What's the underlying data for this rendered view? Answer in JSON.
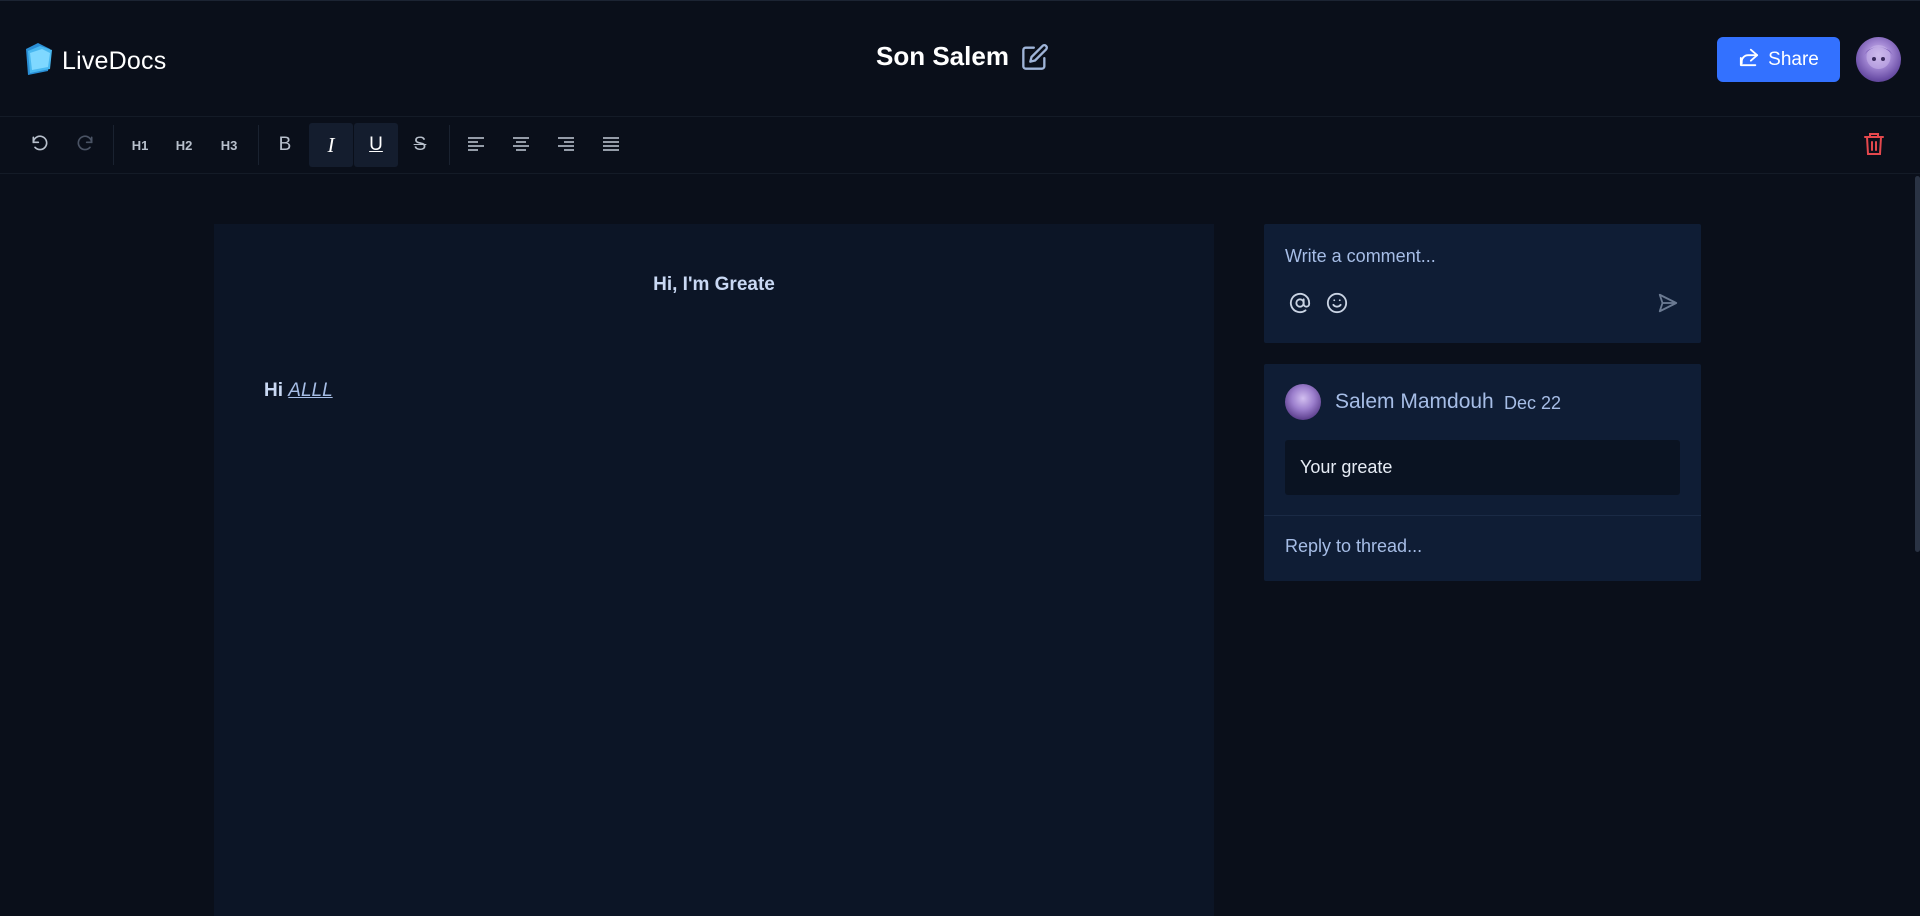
{
  "app": {
    "name": "LiveDocs"
  },
  "header": {
    "title": "Son Salem",
    "share_label": "Share"
  },
  "toolbar": {
    "h1": "H1",
    "h2": "H2",
    "h3": "H3",
    "bold": "B",
    "italic": "I",
    "underline": "U",
    "strike": "S"
  },
  "document": {
    "heading": "Hi, I'm Greate",
    "paragraph_prefix": "Hi ",
    "paragraph_emphasis": "ALLL"
  },
  "comments": {
    "placeholder": "Write a comment...",
    "thread": {
      "author": "Salem Mamdouh",
      "date": "Dec 22",
      "body": "Your greate",
      "reply_placeholder": "Reply to thread..."
    }
  },
  "colors": {
    "background": "#0a0f1a",
    "page": "#0c1526",
    "panel": "#0f1d35",
    "accent": "#3371ff",
    "danger": "#e5484d"
  }
}
